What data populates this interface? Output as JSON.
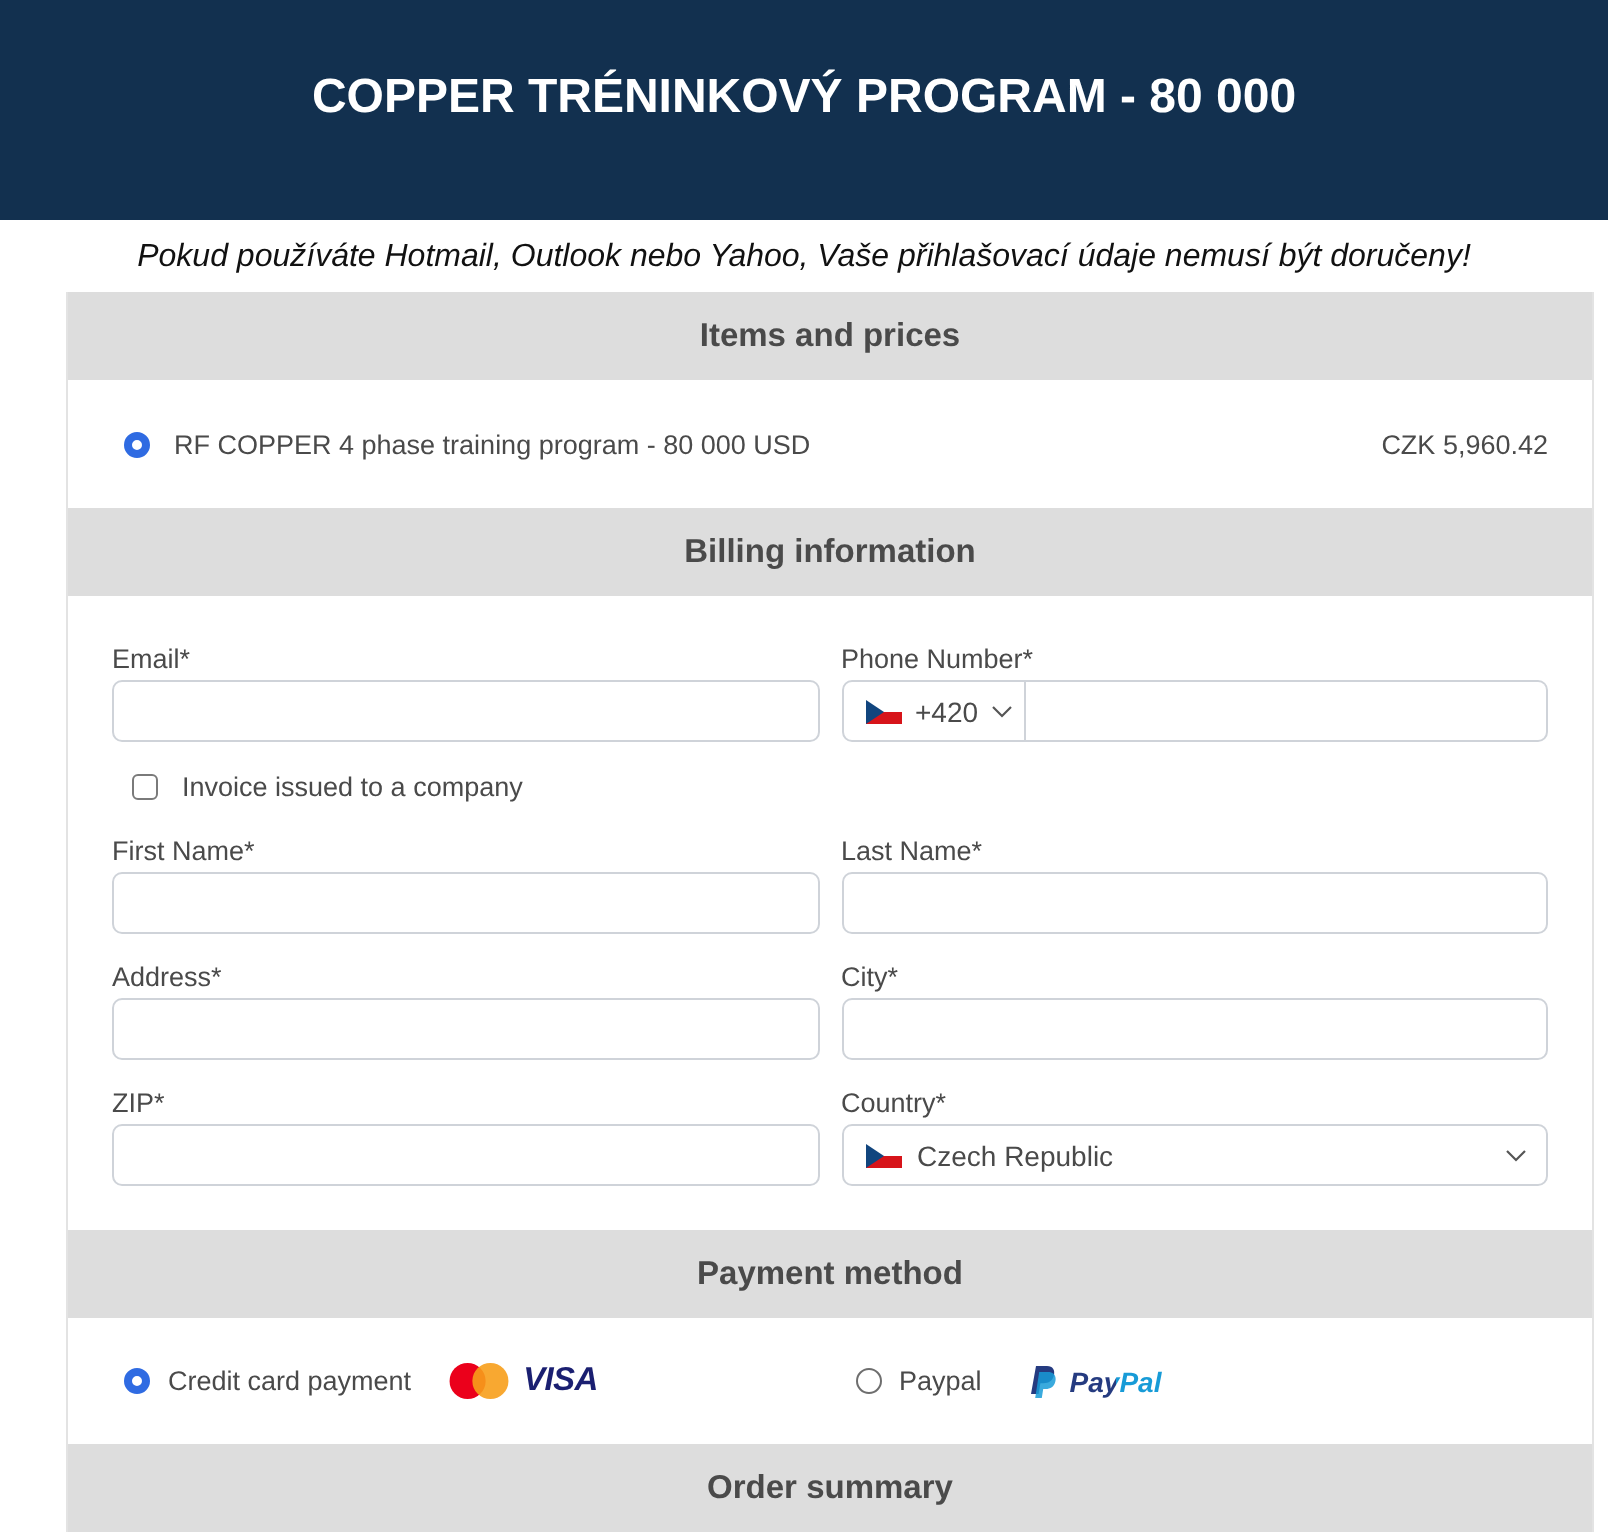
{
  "header": {
    "title": "COPPER TRÉNINKOVÝ PROGRAM - 80 000"
  },
  "notice": "Pokud používáte Hotmail, Outlook nebo Yahoo, Vaše přihlašovací údaje nemusí být doručeny!",
  "items": {
    "heading": "Items and prices",
    "options": [
      {
        "name": "RF COPPER 4 phase training program - 80 000 USD",
        "price": "CZK 5,960.42",
        "selected": true
      }
    ]
  },
  "billing": {
    "heading": "Billing information",
    "fields": [
      {
        "kind": "text",
        "label": "Email*"
      },
      {
        "kind": "phone",
        "label": "Phone Number*",
        "dial_code": "+420"
      },
      {
        "kind": "checkbox",
        "label": "Invoice issued to a company",
        "checked": false
      },
      {
        "kind": "text",
        "label": "First Name*"
      },
      {
        "kind": "text",
        "label": "Last Name*"
      },
      {
        "kind": "text",
        "label": "Address*"
      },
      {
        "kind": "text",
        "label": "City*"
      },
      {
        "kind": "text",
        "label": "ZIP*"
      },
      {
        "kind": "select",
        "label": "Country*",
        "value": "Czech Republic"
      }
    ]
  },
  "payment": {
    "heading": "Payment method",
    "options": [
      {
        "kind": "card",
        "label": "Credit card payment",
        "logo_text": "VISA",
        "selected": true
      },
      {
        "kind": "paypal",
        "label": "Paypal",
        "logo_text": "PayPal",
        "selected": false
      }
    ]
  },
  "summary": {
    "heading": "Order summary"
  }
}
